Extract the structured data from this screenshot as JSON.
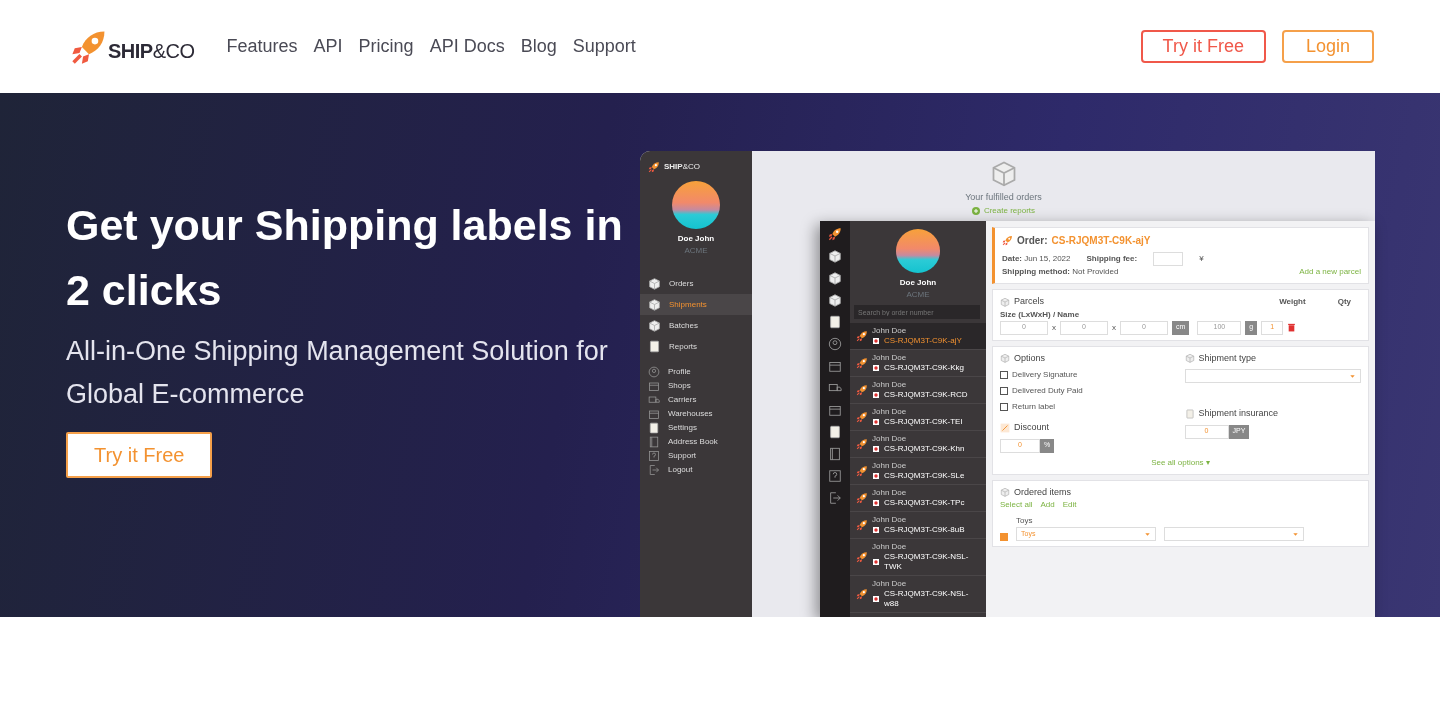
{
  "nav": {
    "logo": "**SHIP**&CO",
    "links": [
      "Features",
      "API",
      "Pricing",
      "API Docs",
      "Blog",
      "Support"
    ],
    "buttons": [
      {
        "label": "Try it Free",
        "kind": "signup"
      },
      {
        "label": "Login",
        "kind": "login"
      }
    ]
  },
  "hero": {
    "title": "Get your Shipping labels in 2 clicks",
    "subtitle": "All-in-One Shipping Management Solution for Global E-commerce",
    "cta": "Try it Free"
  },
  "app_back": {
    "logo": "**SHIP**&CO",
    "user": "Doe John",
    "company": "ACME",
    "menu": [
      {
        "label": "Orders",
        "selected": false
      },
      {
        "label": "Shipments",
        "selected": true
      },
      {
        "label": "Batches",
        "selected": false
      },
      {
        "label": "Reports",
        "selected": false
      }
    ],
    "settings_menu": [
      "Profile",
      "Shops",
      "Carriers",
      "Warehouses",
      "Settings",
      "Address Book",
      "Support",
      "Logout"
    ],
    "empty_title": "Your fulfilled orders",
    "empty_action": "Create reports"
  },
  "app_front": {
    "user": "Doe John",
    "company": "ACME",
    "search_placeholder": "Search by order number",
    "orders": [
      {
        "customer": "John Doe",
        "id": "CS-RJQM3T-C9K-ajY",
        "selected": true
      },
      {
        "customer": "John Doe",
        "id": "CS-RJQM3T-C9K-Kkg",
        "selected": false
      },
      {
        "customer": "John Doe",
        "id": "CS-RJQM3T-C9K-RCD",
        "selected": false
      },
      {
        "customer": "John Doe",
        "id": "CS-RJQM3T-C9K-TEI",
        "selected": false
      },
      {
        "customer": "John Doe",
        "id": "CS-RJQM3T-C9K-Khn",
        "selected": false
      },
      {
        "customer": "John Doe",
        "id": "CS-RJQM3T-C9K-SLe",
        "selected": false
      },
      {
        "customer": "John Doe",
        "id": "CS-RJQM3T-C9K-TPc",
        "selected": false
      },
      {
        "customer": "John Doe",
        "id": "CS-RJQM3T-C9K-8uB",
        "selected": false
      },
      {
        "customer": "John Doe",
        "id": "CS-RJQM3T-C9K-NSL-TWK",
        "selected": false
      },
      {
        "customer": "John Doe",
        "id": "CS-RJQM3T-C9K-NSL-w88",
        "selected": false
      }
    ],
    "order": {
      "label": "Order:",
      "id": "CS-RJQM3T-C9K-ajY",
      "date": "**Date:** Jun 15, 2022",
      "method": "**Shipping method:** Not Provided",
      "fee_label": "Shipping fee:",
      "fee_unit": "¥",
      "add_parcel": "Add a new parcel",
      "parcels": {
        "title": "Parcels",
        "size_label": "Size (LxWxH) / Name",
        "weight_label": "Weight",
        "qty_label": "Qty",
        "dims": [
          "0",
          "0",
          "0"
        ],
        "separators": [
          "x",
          "x"
        ],
        "dim_unit": "cm",
        "weight": "100",
        "weight_unit": "g",
        "qty": "1"
      },
      "options": {
        "title": "Options",
        "checks": [
          {
            "label": "Delivery Signature",
            "checked": false
          },
          {
            "label": "Delivered Duty Paid",
            "checked": false
          },
          {
            "label": "Return label",
            "checked": false
          }
        ],
        "discount_title": "Discount",
        "discount": "0",
        "discount_unit": "%",
        "type_title": "Shipment type",
        "insurance_title": "Shipment insurance",
        "insurance": "0",
        "insurance_unit": "JPY",
        "more": "See all options ▾"
      },
      "items": {
        "title": "Ordered items",
        "actions": [
          "Select all",
          "Add",
          "Edit"
        ],
        "rows": [
          {
            "checked": true,
            "category_label": "Toys",
            "category": "Toys"
          }
        ]
      }
    }
  }
}
